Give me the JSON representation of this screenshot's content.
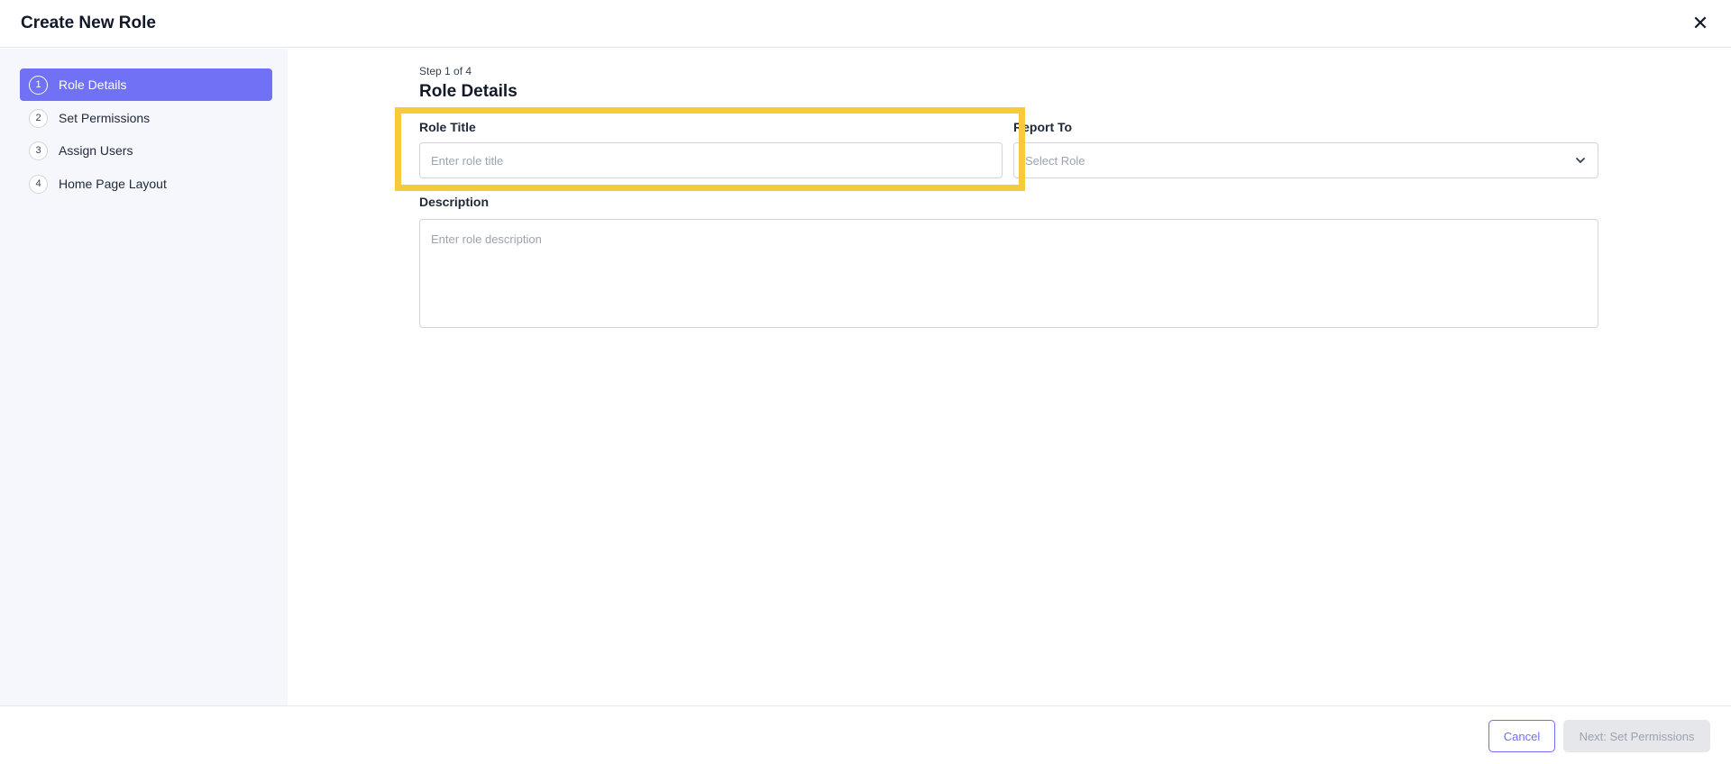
{
  "modal": {
    "title": "Create New Role",
    "close_label": "✕"
  },
  "steps": [
    {
      "number": "1",
      "label": "Role Details",
      "active": true
    },
    {
      "number": "2",
      "label": "Set Permissions",
      "active": false
    },
    {
      "number": "3",
      "label": "Assign Users",
      "active": false
    },
    {
      "number": "4",
      "label": "Home Page Layout",
      "active": false
    }
  ],
  "main": {
    "step_counter": "Step 1 of 4",
    "section_title": "Role Details",
    "role_title": {
      "label": "Role Title",
      "placeholder": "Enter role title",
      "value": ""
    },
    "report_to": {
      "label": "Report To",
      "placeholder": "Select Role"
    },
    "description": {
      "label": "Description",
      "placeholder": "Enter role description",
      "value": ""
    }
  },
  "footer": {
    "cancel_label": "Cancel",
    "next_label": "Next: Set Permissions"
  },
  "colors": {
    "accent": "#7071f5",
    "highlight": "#f7ca3b",
    "sidebar_bg": "#f6f6fd"
  },
  "icons": {
    "close": "close-icon",
    "chevron": "chevron-down-icon"
  }
}
